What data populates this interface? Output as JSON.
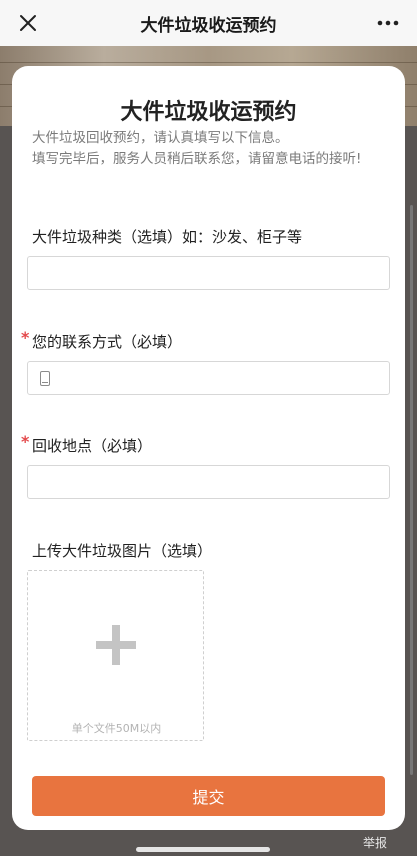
{
  "navbar": {
    "title": "大件垃圾收运预约",
    "close_icon": "close-icon",
    "more_icon": "more-dots-icon"
  },
  "form": {
    "title": "大件垃圾收运预约",
    "intro_line1": "大件垃圾回收预约，请认真填写以下信息。",
    "intro_line2": "填写完毕后，服务人员稍后联系您，请留意电话的接听!",
    "fields": [
      {
        "label": "大件垃圾种类（选填）如：沙发、柜子等",
        "required": false,
        "value": ""
      },
      {
        "label": "您的联系方式（必填）",
        "required": true,
        "value": "",
        "icon": "phone-icon"
      },
      {
        "label": "回收地点（必填）",
        "required": true,
        "value": ""
      }
    ],
    "required_mark": "*",
    "upload": {
      "label": "上传大件垃圾图片（选填）",
      "hint": "单个文件50M以内",
      "icon": "plus-icon"
    },
    "submit_label": "提交"
  },
  "footer": {
    "report_label": "举报"
  },
  "colors": {
    "accent": "#e8743f",
    "required": "#e3494b",
    "page_background": "#585452"
  }
}
